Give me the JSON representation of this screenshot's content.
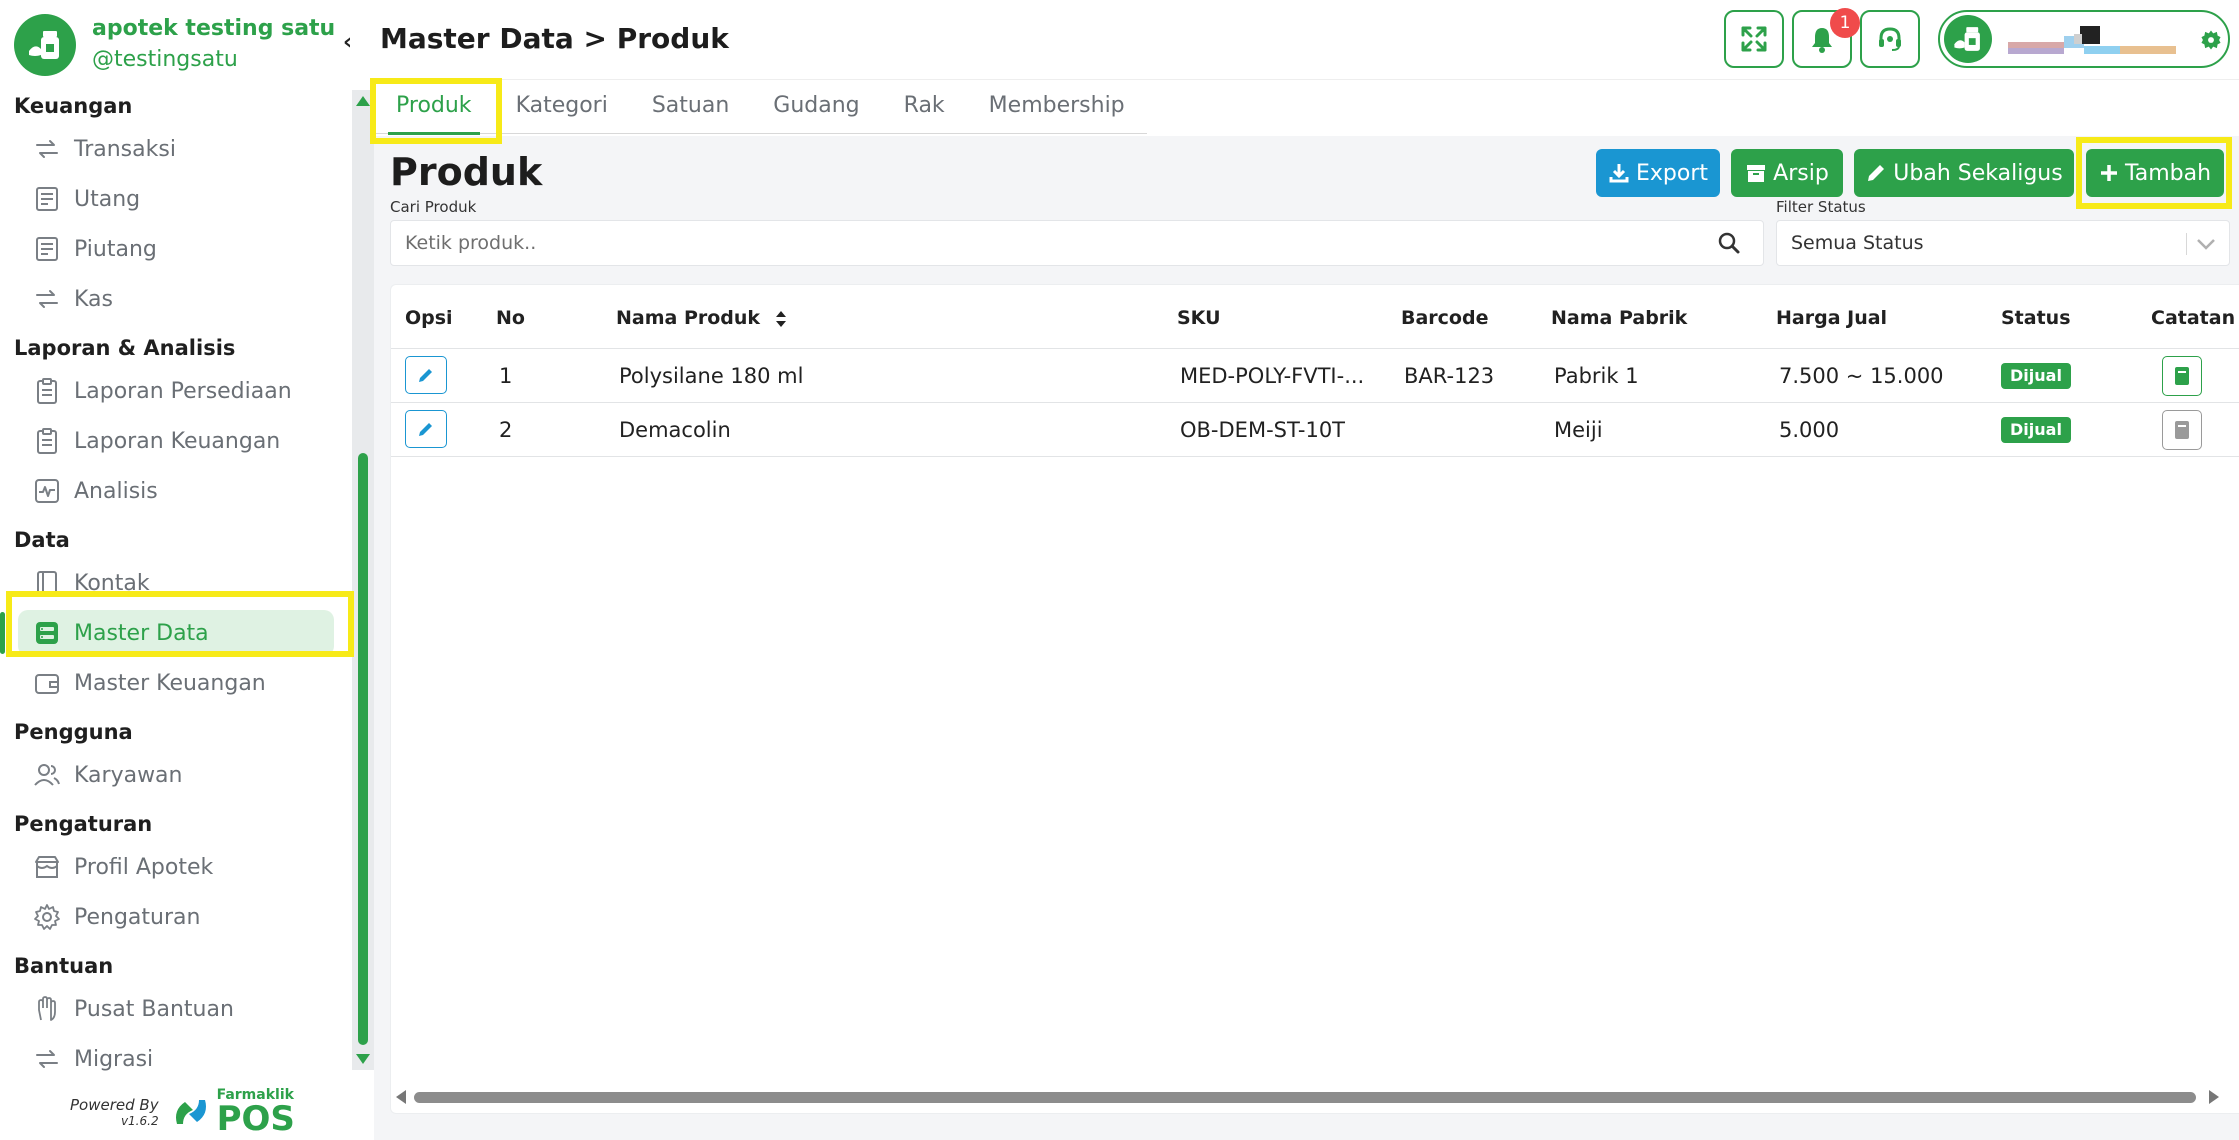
{
  "brand": {
    "name": "apotek testing satu",
    "handle": "@testingsatu"
  },
  "sidebar": {
    "groups": [
      {
        "title": "Keuangan",
        "items": [
          {
            "label": "Transaksi",
            "icon": "exchange-icon"
          },
          {
            "label": "Utang",
            "icon": "receipt-icon"
          },
          {
            "label": "Piutang",
            "icon": "receipt-icon"
          },
          {
            "label": "Kas",
            "icon": "exchange-icon"
          }
        ]
      },
      {
        "title": "Laporan & Analisis",
        "items": [
          {
            "label": "Laporan Persediaan",
            "icon": "clipboard-icon"
          },
          {
            "label": "Laporan Keuangan",
            "icon": "clipboard-icon"
          },
          {
            "label": "Analisis",
            "icon": "pulse-chart-icon"
          }
        ]
      },
      {
        "title": "Data",
        "items": [
          {
            "label": "Kontak",
            "icon": "contact-book-icon"
          },
          {
            "label": "Master Data",
            "icon": "server-icon",
            "active": true
          },
          {
            "label": "Master Keuangan",
            "icon": "wallet-icon"
          }
        ]
      },
      {
        "title": "Pengguna",
        "items": [
          {
            "label": "Karyawan",
            "icon": "users-icon"
          }
        ]
      },
      {
        "title": "Pengaturan",
        "items": [
          {
            "label": "Profil Apotek",
            "icon": "store-icon"
          },
          {
            "label": "Pengaturan",
            "icon": "gear-icon"
          }
        ]
      },
      {
        "title": "Bantuan",
        "items": [
          {
            "label": "Pusat Bantuan",
            "icon": "hand-icon"
          },
          {
            "label": "Migrasi",
            "icon": "exchange-icon"
          }
        ]
      }
    ],
    "powered_by": "Powered By",
    "version": "v1.6.2",
    "product_small": "Farmaklik",
    "product_big": "POS"
  },
  "header": {
    "title": "Master Data > Produk",
    "notification_count": "1"
  },
  "tabs": [
    "Produk",
    "Kategori",
    "Satuan",
    "Gudang",
    "Rak",
    "Membership"
  ],
  "main": {
    "title": "Produk",
    "buttons": {
      "export": "Export",
      "arsip": "Arsip",
      "ubah": "Ubah Sekaligus",
      "tambah": "Tambah"
    },
    "search_label": "Cari Produk",
    "search_placeholder": "Ketik produk..",
    "filter_label": "Filter Status",
    "filter_value": "Semua Status"
  },
  "table": {
    "columns": [
      "Opsi",
      "No",
      "Nama Produk",
      "SKU",
      "Barcode",
      "Nama Pabrik",
      "Harga Jual",
      "Status",
      "Catatan"
    ],
    "rows": [
      {
        "no": "1",
        "name": "Polysilane 180 ml",
        "sku": "MED-POLY-FVTI-...",
        "barcode": "BAR-123",
        "pabrik": "Pabrik 1",
        "harga": "7.500 ~ 15.000",
        "status": "Dijual",
        "has_note": true
      },
      {
        "no": "2",
        "name": "Demacolin",
        "sku": "OB-DEM-ST-10T",
        "barcode": "",
        "pabrik": "Meiji",
        "harga": "5.000",
        "status": "Dijual",
        "has_note": false
      }
    ]
  },
  "colors": {
    "primary": "#2da14a",
    "info": "#1a96d2",
    "highlight": "#f7ea18",
    "danger": "#f04b4b"
  }
}
